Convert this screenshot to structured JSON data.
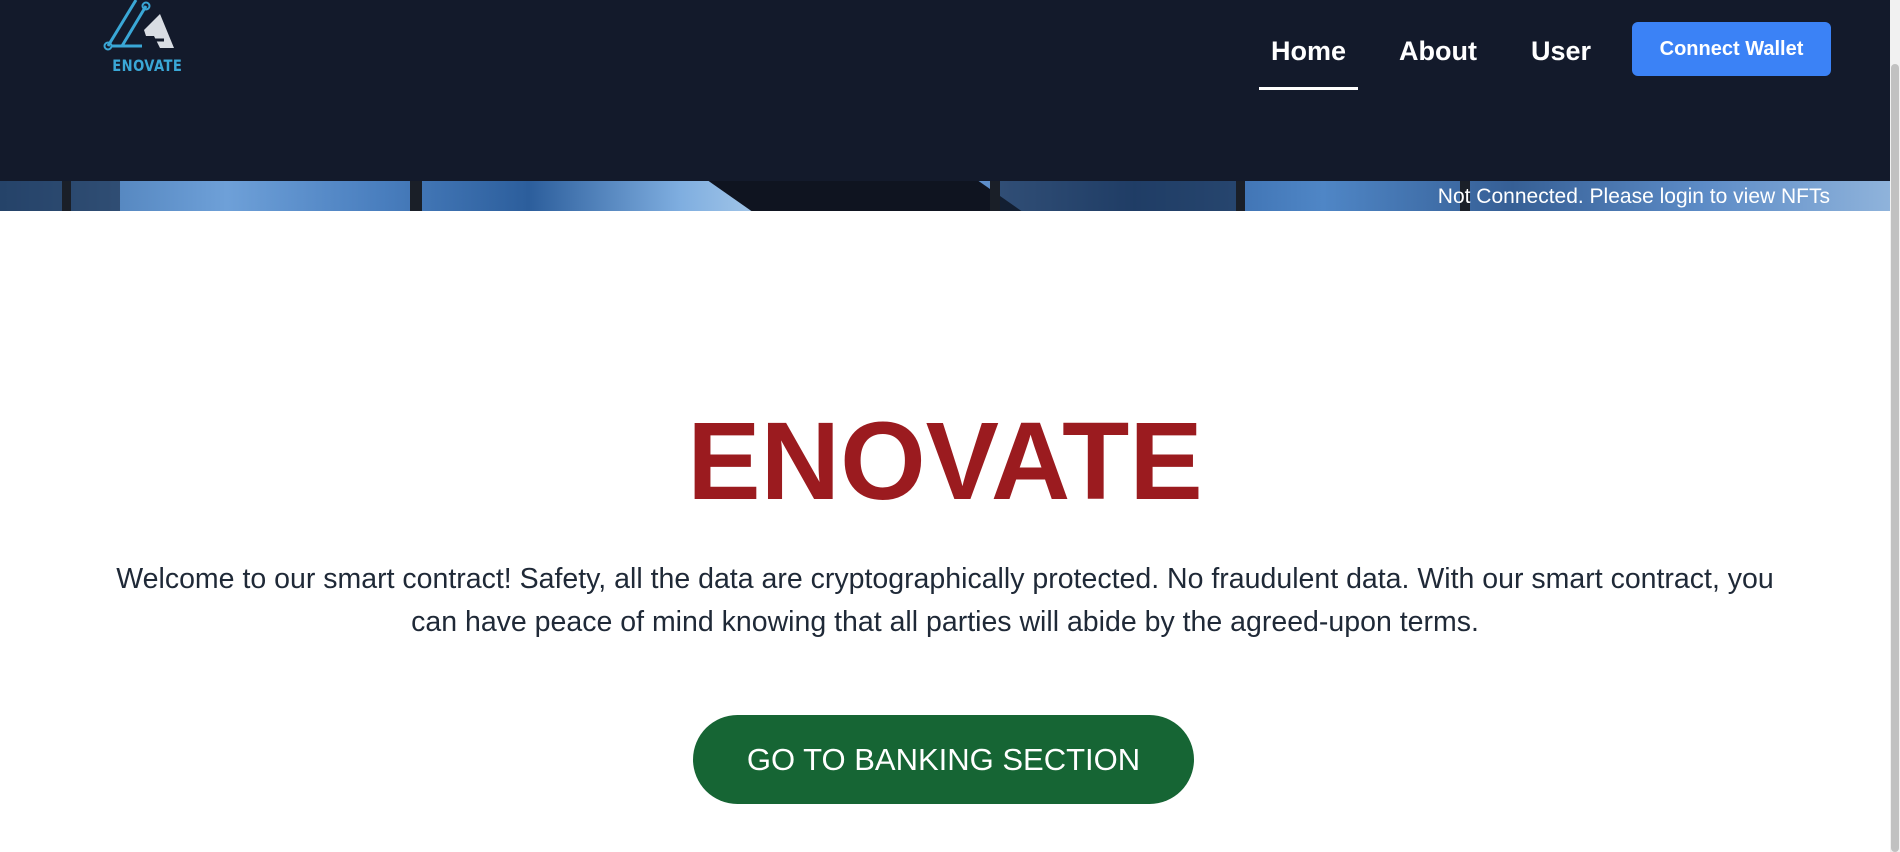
{
  "header": {
    "logo_text": "ENOVATE",
    "nav": [
      {
        "label": "Home",
        "active": true
      },
      {
        "label": "About",
        "active": false
      },
      {
        "label": "User",
        "active": false
      }
    ],
    "connect_label": "Connect Wallet"
  },
  "banner": {
    "status_text": "Not Connected. Please login to view NFTs"
  },
  "hero": {
    "title": "ENOVATE",
    "description": "Welcome to our smart contract! Safety, all the data are cryptographically protected. No fraudulent data. With our smart contract, you can have peace of mind knowing that all parties will abide by the agreed-upon terms.",
    "cta_label": "GO TO BANKING SECTION"
  },
  "colors": {
    "navbar_bg": "#131a2b",
    "accent_blue": "#3b82f6",
    "title_red": "#9b1b1f",
    "cta_green": "#166534",
    "logo_cyan": "#3aa7d6"
  },
  "icons": {
    "logo": "enovate-logo-icon"
  }
}
